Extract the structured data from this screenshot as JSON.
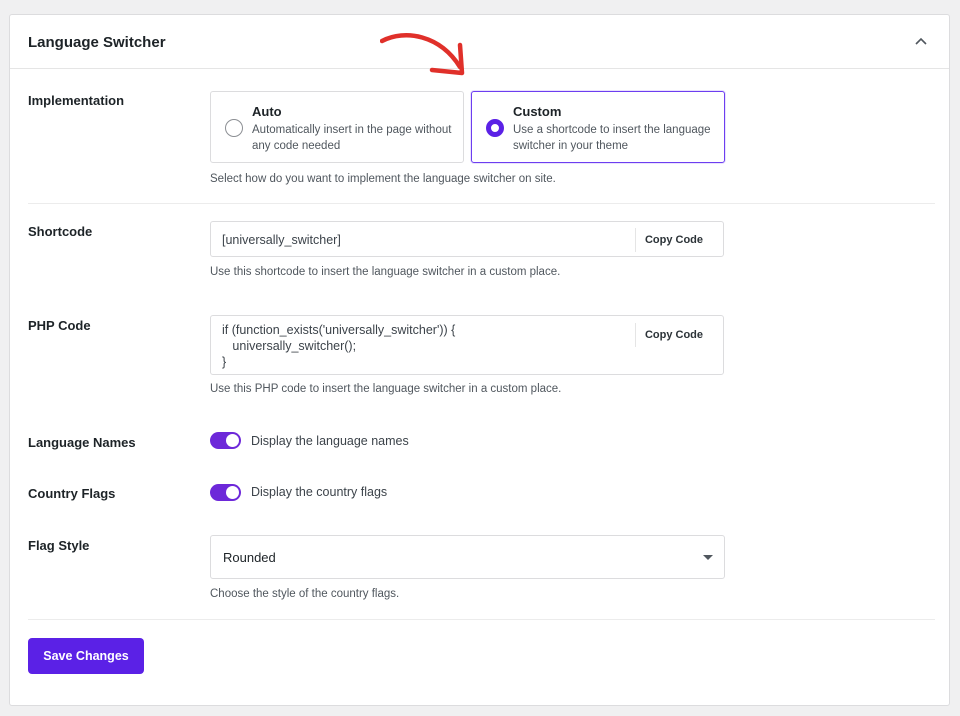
{
  "panel": {
    "title": "Language Switcher"
  },
  "implementation": {
    "label": "Implementation",
    "options": [
      {
        "title": "Auto",
        "description": "Automatically insert in the page without any code needed",
        "selected": false
      },
      {
        "title": "Custom",
        "description": "Use a shortcode to insert the language switcher in your theme",
        "selected": true
      }
    ],
    "help": "Select how do you want to implement the language switcher on site."
  },
  "shortcode": {
    "label": "Shortcode",
    "value": "[universally_switcher]",
    "copy_label": "Copy Code",
    "help": "Use this shortcode to insert the language switcher in a custom place."
  },
  "php_code": {
    "label": "PHP Code",
    "value": "if (function_exists('universally_switcher')) {\n   universally_switcher();\n}",
    "copy_label": "Copy Code",
    "help": "Use this PHP code to insert the language switcher in a custom place."
  },
  "language_names": {
    "label": "Language Names",
    "toggle_label": "Display the language names",
    "enabled": true
  },
  "country_flags": {
    "label": "Country Flags",
    "toggle_label": "Display the country flags",
    "enabled": true
  },
  "flag_style": {
    "label": "Flag Style",
    "selected": "Rounded",
    "help": "Choose the style of the country flags."
  },
  "actions": {
    "save_label": "Save Changes"
  },
  "colors": {
    "accent": "#5b21e6",
    "annotation_arrow": "#e0302a"
  },
  "icons": {
    "collapse": "chevron-up-icon",
    "select": "caret-down-icon",
    "annotation": "curved-arrow-icon"
  }
}
